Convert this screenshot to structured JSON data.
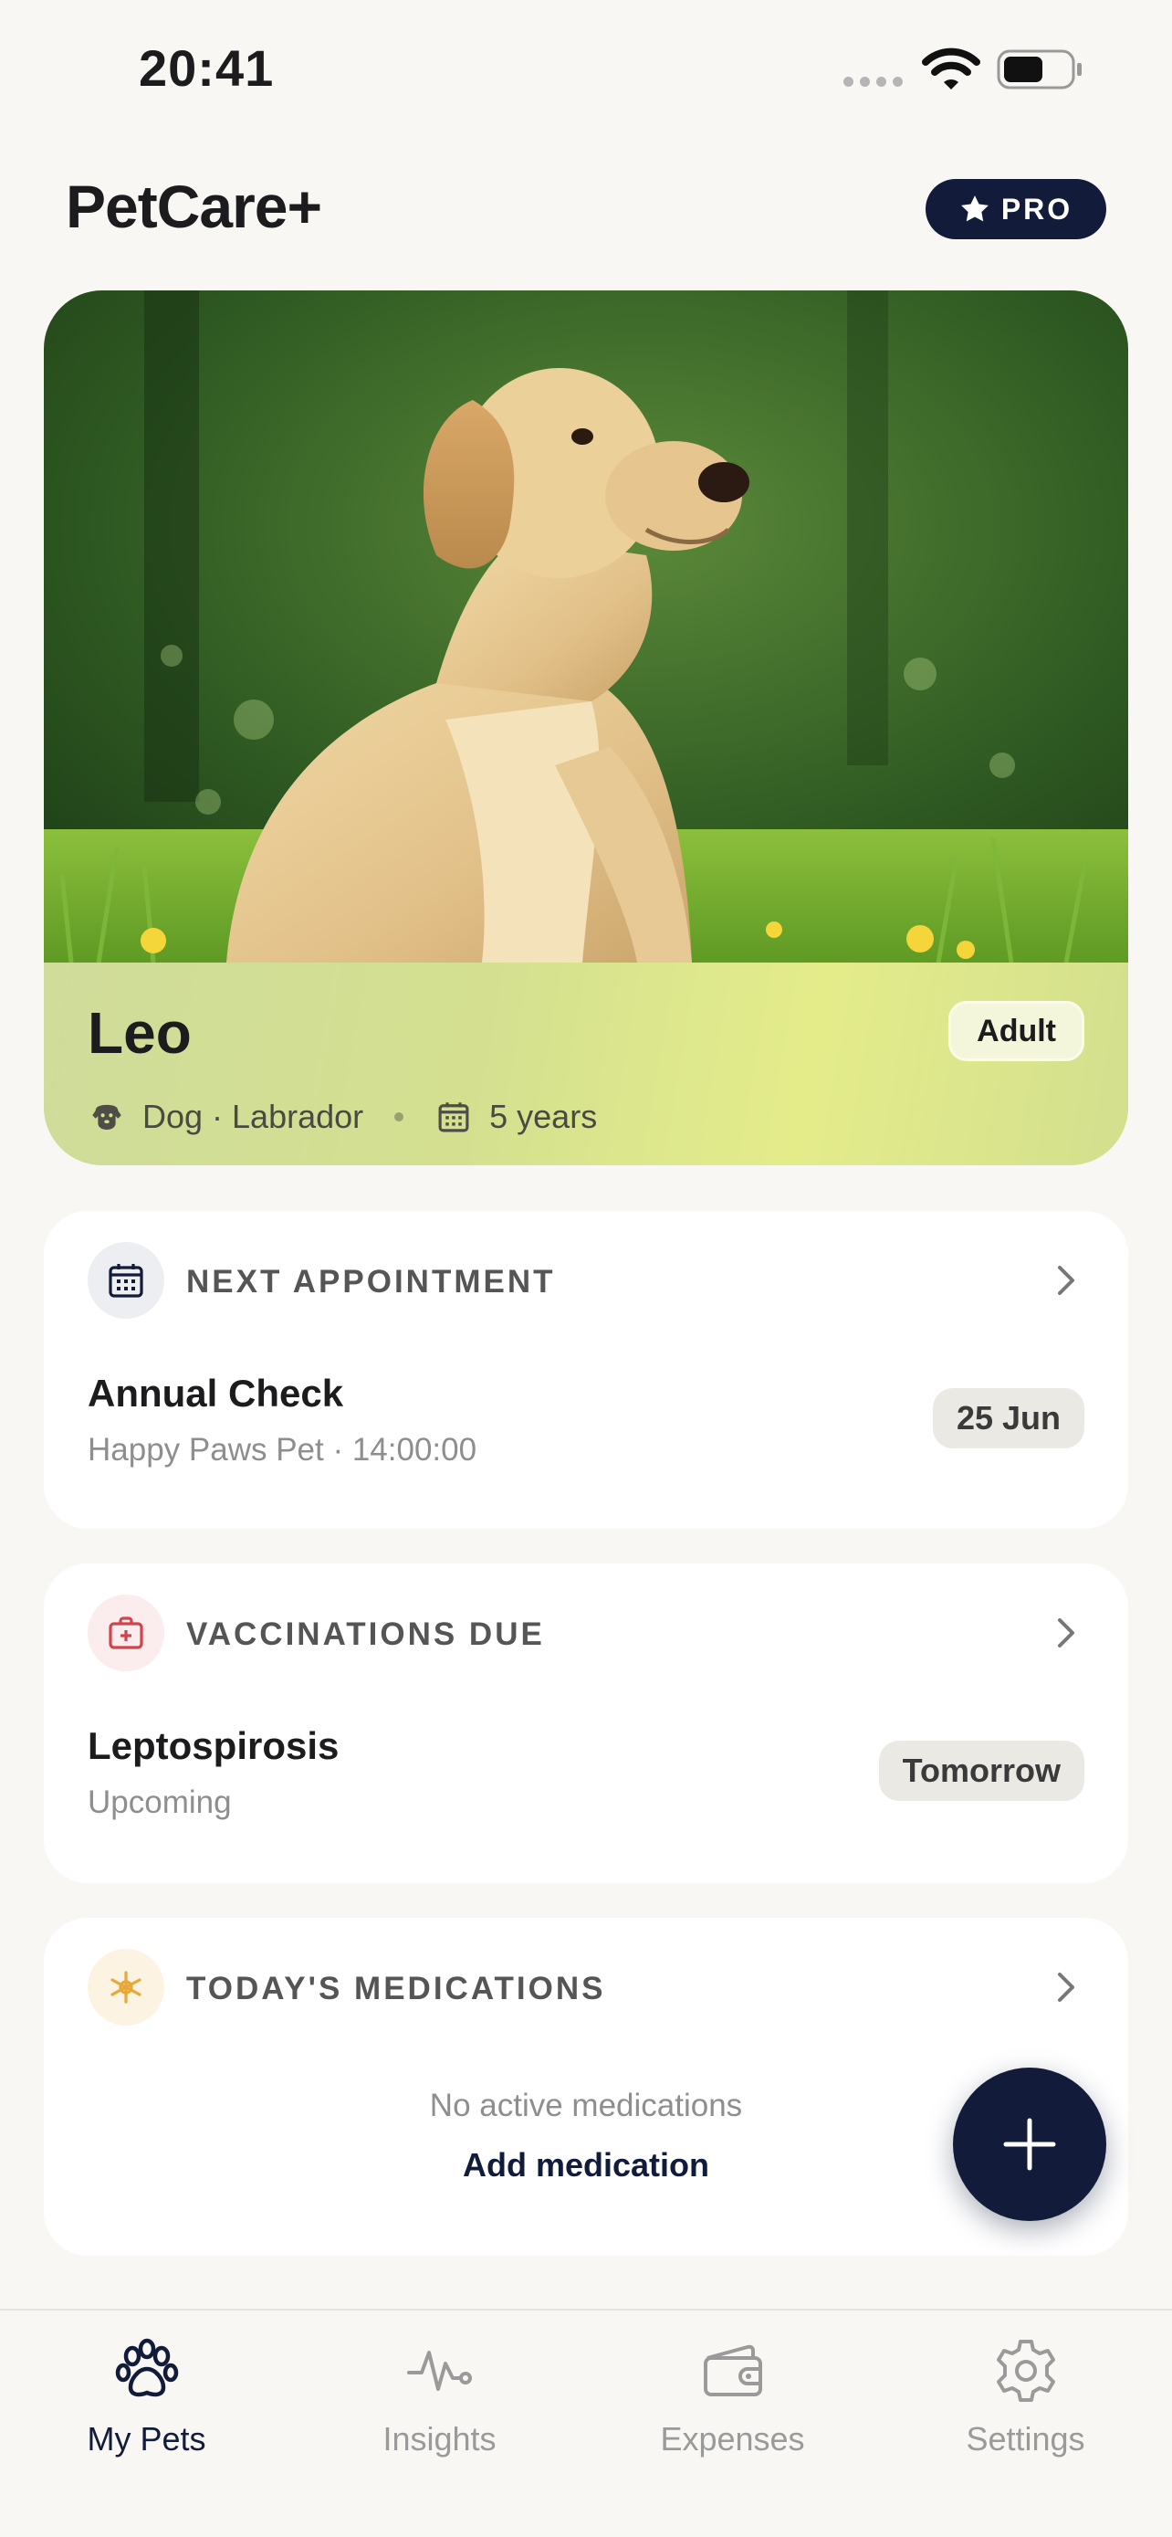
{
  "status_bar": {
    "time": "20:41"
  },
  "header": {
    "title": "PetCare+",
    "pro_badge": "PRO"
  },
  "pet": {
    "name": "Leo",
    "life_stage": "Adult",
    "species_breed": "Dog · Labrador",
    "age": "5 years"
  },
  "next_appointment": {
    "title": "NEXT APPOINTMENT",
    "name": "Annual Check",
    "details": "Happy Paws Pet · 14:00:00",
    "date": "25 Jun"
  },
  "vaccinations": {
    "title": "VACCINATIONS DUE",
    "name": "Leptospirosis",
    "status": "Upcoming",
    "due": "Tomorrow"
  },
  "medications": {
    "title": "TODAY'S MEDICATIONS",
    "empty_text": "No active medications",
    "add_label": "Add medication"
  },
  "tabs": [
    {
      "label": "My Pets",
      "icon": "paw-icon",
      "active": true
    },
    {
      "label": "Insights",
      "icon": "activity-icon",
      "active": false
    },
    {
      "label": "Expenses",
      "icon": "wallet-icon",
      "active": false
    },
    {
      "label": "Settings",
      "icon": "gear-icon",
      "active": false
    }
  ],
  "colors": {
    "primary": "#121c3a",
    "background": "#f8f7f4",
    "card": "#ffffff",
    "pet_card_accent": "#d4e090",
    "vaccination_accent": "#d0454c",
    "medication_accent": "#e8a838"
  }
}
